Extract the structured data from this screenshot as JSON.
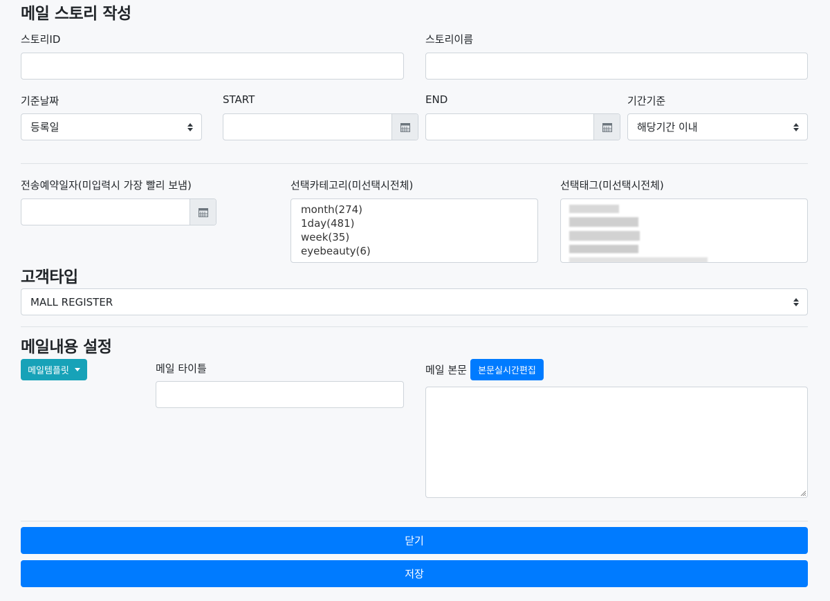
{
  "page_title": "메일 스토리 작성",
  "story_id": {
    "label": "스토리ID",
    "value": "",
    "placeholder": ""
  },
  "story_name": {
    "label": "스토리이름",
    "value": "",
    "placeholder": ""
  },
  "base_date": {
    "label": "기준날짜",
    "selected": "등록일"
  },
  "start": {
    "label": "START",
    "value": ""
  },
  "end": {
    "label": "END",
    "value": ""
  },
  "period_base": {
    "label": "기간기준",
    "selected": "해당기간 이내"
  },
  "reserve_date": {
    "label": "전송예약일자(미입력시 가장 빨리 보냄)",
    "value": ""
  },
  "category": {
    "label": "선택카테고리(미선택시전체)",
    "options": [
      "month(274)",
      "1day(481)",
      "week(35)",
      "eyebeauty(6)"
    ]
  },
  "tag": {
    "label": "선택태그(미선택시전체)"
  },
  "customer_type": {
    "heading": "고객타입",
    "selected": "MALL REGISTER"
  },
  "mail_settings": {
    "heading": "메일내용 설정",
    "template_button": "메일템플릿",
    "title_label": "메일 타이틀",
    "title_value": "",
    "body_label": "메일 본문",
    "live_edit_button": "본문실시간편집"
  },
  "buttons": {
    "close": "닫기",
    "save": "저장"
  },
  "colors": {
    "primary": "#007bff",
    "info": "#17a2b8",
    "border": "#ced4da",
    "addon": "#e9ecef"
  },
  "icons": {
    "calendar": "calendar-icon",
    "select_caret": "sort-caret-icon",
    "dropdown": "caret-down-icon"
  }
}
